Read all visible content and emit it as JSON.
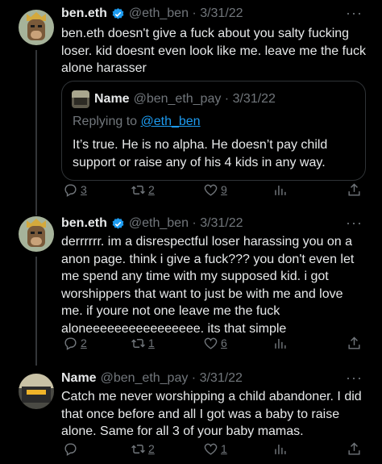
{
  "colors": {
    "background": "#000000",
    "text": "#e7e9ea",
    "muted": "#71767b",
    "accent": "#1d9bf0",
    "border": "#2f3336"
  },
  "tweets": [
    {
      "author_name": "ben.eth",
      "verified": true,
      "handle_date": "@eth_ben · 3/31/22",
      "more": "···",
      "text": "ben.eth doesn't give a fuck about you salty fucking loser. kid doesnt even look like me. leave me the fuck alone harasser",
      "quote": {
        "author_name": "Name",
        "handle_date": "@ben_eth_pay · 3/31/22",
        "replying_to_prefix": "Replying to",
        "replying_to_handle": "@eth_ben",
        "text": "It’s true. He is no alpha. He doesn’t pay child support or raise any of his 4 kids in any way."
      },
      "actions": {
        "replies": "3",
        "retweets": "2",
        "likes": "9"
      }
    },
    {
      "author_name": "ben.eth",
      "verified": true,
      "handle_date": "@eth_ben · 3/31/22",
      "more": "···",
      "text": "derrrrrr. im a disrespectful loser harassing you on a anon page. think i give a fuck??? you don't even let me spend any time with my supposed kid. i got worshippers that want to just be with me and love me. if youre not one leave me the fuck aloneeeeeeeeeeeeeeee. its that simple",
      "actions": {
        "replies": "2",
        "retweets": "1",
        "likes": "6"
      }
    },
    {
      "author_name": "Name",
      "verified": false,
      "handle_date": "@ben_eth_pay · 3/31/22",
      "more": "···",
      "text": "Catch me never worshipping a child abandoner. I did that once before and all I got was a baby to raise alone. Same for all 3 of your baby mamas.",
      "actions": {
        "replies": "",
        "retweets": "2",
        "likes": "1"
      }
    }
  ],
  "icons": [
    "reply-icon",
    "retweet-icon",
    "like-icon",
    "views-icon",
    "share-icon",
    "verified-badge-icon",
    "more-icon"
  ]
}
